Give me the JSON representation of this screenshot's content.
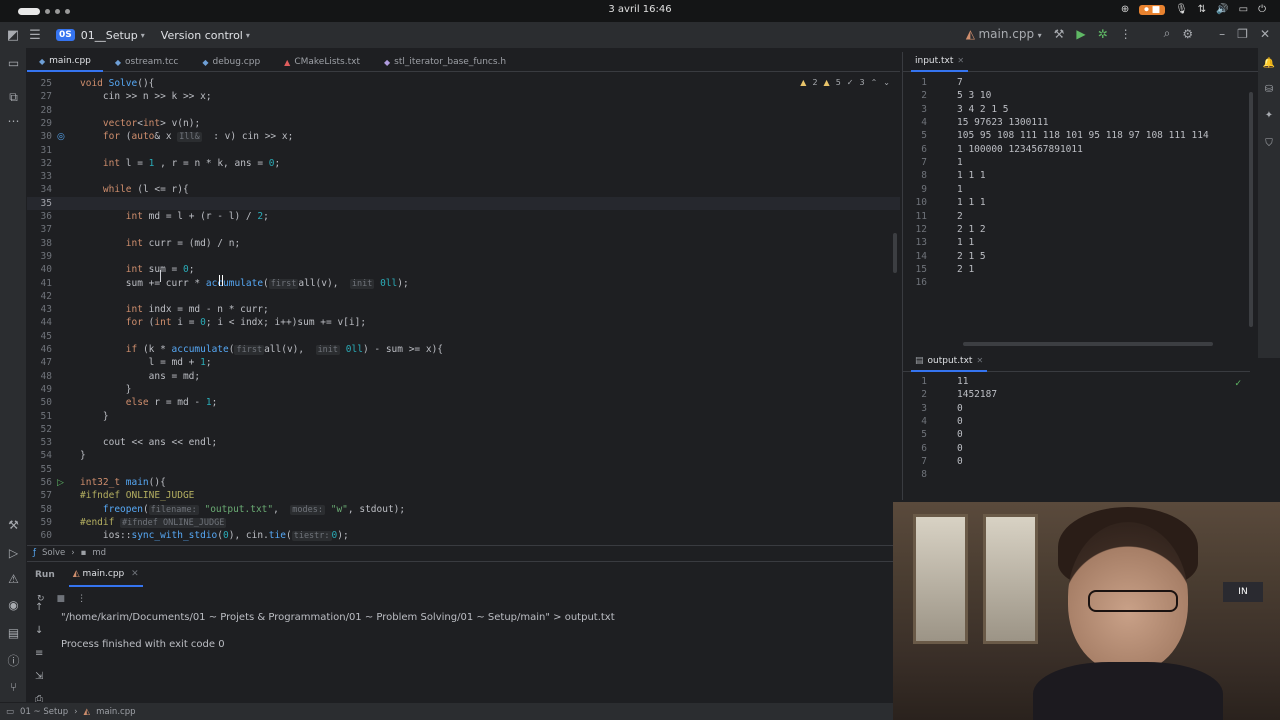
{
  "os": {
    "clock": "3 avril 16:46"
  },
  "titlebar": {
    "project_badge": "0S",
    "project_name": "01__Setup",
    "vcs": "Version control",
    "run_config": "main.cpp"
  },
  "tabs": [
    {
      "label": "main.cpp",
      "active": true
    },
    {
      "label": "ostream.tcc"
    },
    {
      "label": "debug.cpp"
    },
    {
      "label": "CMakeLists.txt"
    },
    {
      "label": "stl_iterator_base_funcs.h"
    }
  ],
  "editor": {
    "warn_a": "2",
    "warn_b": "5",
    "warn_c": "3",
    "lines": [
      {
        "n": "25",
        "segs": [
          [
            "kw",
            "void "
          ],
          [
            "fn",
            "Solve"
          ],
          [
            "",
            "(){"
          ]
        ]
      },
      {
        "n": "27",
        "segs": [
          [
            "",
            "    cin >> n >> k >> x;"
          ]
        ]
      },
      {
        "n": "28",
        "segs": [
          [
            "",
            ""
          ]
        ]
      },
      {
        "n": "29",
        "segs": [
          [
            "",
            "    "
          ],
          [
            "ty",
            "vector"
          ],
          [
            "",
            "<"
          ],
          [
            "ty",
            "int"
          ],
          [
            "",
            "> v(n);"
          ]
        ]
      },
      {
        "n": "30",
        "segs": [
          [
            "",
            "    "
          ],
          [
            "kw",
            "for "
          ],
          [
            "",
            "("
          ],
          [
            "kw",
            "auto"
          ],
          [
            "",
            "& x "
          ],
          [
            "hint",
            "Ill&"
          ],
          [
            "",
            "  : v) cin >> x;"
          ]
        ]
      },
      {
        "n": "31",
        "segs": [
          [
            "",
            ""
          ]
        ]
      },
      {
        "n": "32",
        "segs": [
          [
            "",
            "    "
          ],
          [
            "ty",
            "int "
          ],
          [
            "",
            "l = "
          ],
          [
            "num",
            "1"
          ],
          [
            "",
            " , r = n * k, ans = "
          ],
          [
            "num",
            "0"
          ],
          [
            "",
            ";"
          ]
        ]
      },
      {
        "n": "33",
        "segs": [
          [
            "",
            ""
          ]
        ]
      },
      {
        "n": "34",
        "segs": [
          [
            "",
            "    "
          ],
          [
            "kw",
            "while "
          ],
          [
            "",
            "(l <= r){"
          ]
        ]
      },
      {
        "n": "35",
        "segs": [
          [
            "",
            ""
          ]
        ],
        "current": true
      },
      {
        "n": "36",
        "segs": [
          [
            "",
            "        "
          ],
          [
            "ty",
            "int "
          ],
          [
            "",
            "md = l + (r - l) / "
          ],
          [
            "num",
            "2"
          ],
          [
            "",
            ";"
          ]
        ]
      },
      {
        "n": "37",
        "segs": [
          [
            "",
            ""
          ]
        ]
      },
      {
        "n": "38",
        "segs": [
          [
            "",
            "        "
          ],
          [
            "ty",
            "int "
          ],
          [
            "",
            "curr = (md) / n;"
          ]
        ]
      },
      {
        "n": "39",
        "segs": [
          [
            "",
            ""
          ]
        ]
      },
      {
        "n": "40",
        "segs": [
          [
            "",
            "        "
          ],
          [
            "ty",
            "int "
          ],
          [
            "",
            "sum = "
          ],
          [
            "num",
            "0"
          ],
          [
            "",
            ";"
          ]
        ]
      },
      {
        "n": "41",
        "segs": [
          [
            "",
            "        sum += curr * "
          ],
          [
            "fn",
            "accumulate"
          ],
          [
            "",
            "("
          ],
          [
            "hint",
            "first"
          ],
          [
            "",
            "all(v),  "
          ],
          [
            "hint",
            "init"
          ],
          [
            "",
            " "
          ],
          [
            "num",
            "0ll"
          ],
          [
            "",
            ");"
          ]
        ]
      },
      {
        "n": "42",
        "segs": [
          [
            "",
            ""
          ]
        ]
      },
      {
        "n": "43",
        "segs": [
          [
            "",
            "        "
          ],
          [
            "ty",
            "int "
          ],
          [
            "",
            "indx = md - n * curr;"
          ]
        ]
      },
      {
        "n": "44",
        "segs": [
          [
            "",
            "        "
          ],
          [
            "kw",
            "for "
          ],
          [
            "",
            "("
          ],
          [
            "ty",
            "int "
          ],
          [
            "",
            "i = "
          ],
          [
            "num",
            "0"
          ],
          [
            "",
            "; i < indx; i++)sum += v[i];"
          ]
        ]
      },
      {
        "n": "45",
        "segs": [
          [
            "",
            ""
          ]
        ]
      },
      {
        "n": "46",
        "segs": [
          [
            "",
            "        "
          ],
          [
            "kw",
            "if "
          ],
          [
            "",
            "(k * "
          ],
          [
            "fn",
            "accumulate"
          ],
          [
            "",
            "("
          ],
          [
            "hint",
            "first"
          ],
          [
            "",
            "all(v),  "
          ],
          [
            "hint",
            "init"
          ],
          [
            "",
            " "
          ],
          [
            "num",
            "0ll"
          ],
          [
            "",
            ") - sum >= x){"
          ]
        ]
      },
      {
        "n": "47",
        "segs": [
          [
            "",
            "            l = md + "
          ],
          [
            "num",
            "1"
          ],
          [
            "",
            ";"
          ]
        ]
      },
      {
        "n": "48",
        "segs": [
          [
            "",
            "            ans = md;"
          ]
        ]
      },
      {
        "n": "49",
        "segs": [
          [
            "",
            "        }"
          ]
        ]
      },
      {
        "n": "50",
        "segs": [
          [
            "",
            "        "
          ],
          [
            "kw",
            "else "
          ],
          [
            "",
            "r = md - "
          ],
          [
            "num",
            "1"
          ],
          [
            "",
            ";"
          ]
        ]
      },
      {
        "n": "51",
        "segs": [
          [
            "",
            "    }"
          ]
        ]
      },
      {
        "n": "52",
        "segs": [
          [
            "",
            ""
          ]
        ]
      },
      {
        "n": "53",
        "segs": [
          [
            "",
            "    cout << ans << endl;"
          ]
        ]
      },
      {
        "n": "54",
        "segs": [
          [
            "",
            "}"
          ]
        ]
      },
      {
        "n": "55",
        "segs": [
          [
            "",
            ""
          ]
        ]
      },
      {
        "n": "56",
        "segs": [
          [
            "ty",
            "int32_t "
          ],
          [
            "fn",
            "main"
          ],
          [
            "",
            "(){"
          ]
        ]
      },
      {
        "n": "57",
        "segs": [
          [
            "pre",
            "#ifndef ONLINE_JUDGE"
          ]
        ]
      },
      {
        "n": "58",
        "segs": [
          [
            "",
            "    "
          ],
          [
            "fn",
            "freopen"
          ],
          [
            "",
            "("
          ],
          [
            "hint",
            "filename:"
          ],
          [
            "",
            " "
          ],
          [
            "str",
            "\"output.txt\""
          ],
          [
            "",
            ",  "
          ],
          [
            "hint",
            "modes:"
          ],
          [
            "",
            " "
          ],
          [
            "str",
            "\"w\""
          ],
          [
            "",
            ", stdout);"
          ]
        ]
      },
      {
        "n": "59",
        "segs": [
          [
            "pre",
            "#endif "
          ],
          [
            "hint",
            "#ifndef ONLINE_JUDGE"
          ]
        ]
      },
      {
        "n": "60",
        "segs": [
          [
            "",
            "    ios::"
          ],
          [
            "fn",
            "sync_with_stdio"
          ],
          [
            "",
            "("
          ],
          [
            "num",
            "0"
          ],
          [
            "",
            "), cin."
          ],
          [
            "fn",
            "tie"
          ],
          [
            "",
            "("
          ],
          [
            "hint",
            "tiestr:"
          ],
          [
            "",
            ""
          ],
          [
            "num",
            "0"
          ],
          [
            "",
            ");"
          ]
        ]
      }
    ]
  },
  "breadcrumb": {
    "fn": "Solve",
    "var": "md"
  },
  "run": {
    "label": "Run",
    "tab": "main.cpp",
    "command": "\"/home/karim/Documents/01 ~ Projets & Programmation/01 ~ Problem Solving/01 ~ Setup/main\" > output.txt",
    "result": "Process finished with exit code 0"
  },
  "input_panel": {
    "tab": "input.txt",
    "lines": [
      "7",
      "5 3 10",
      "3 4 2 1 5",
      "15 97623 1300111",
      "105 95 108 111 118 101 95 118 97 108 111 114",
      "1 100000 1234567891011",
      "1",
      "1 1 1",
      "1",
      "1 1 1",
      "2",
      "2 1 2",
      "1 1",
      "2 1 5",
      "2 1",
      ""
    ]
  },
  "output_panel": {
    "tab": "output.txt",
    "lines": [
      "11",
      "1452187",
      "0",
      "0",
      "0",
      "0",
      "0",
      ""
    ]
  },
  "statusbar": {
    "project": "01 ~ Setup",
    "file": "main.cpp"
  }
}
